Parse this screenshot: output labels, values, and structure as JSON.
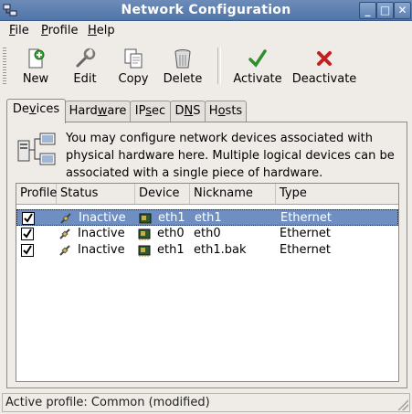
{
  "window": {
    "title": "Network Configuration"
  },
  "menubar": {
    "items": [
      {
        "label": "File",
        "mnemonic": "F",
        "rest": "ile"
      },
      {
        "label": "Profile",
        "mnemonic": "P",
        "rest": "rofile"
      },
      {
        "label": "Help",
        "mnemonic": "H",
        "rest": "elp"
      }
    ]
  },
  "toolbar": {
    "new_label": "New",
    "edit_label": "Edit",
    "copy_label": "Copy",
    "delete_label": "Delete",
    "activate_label": "Activate",
    "deactivate_label": "Deactivate"
  },
  "tabs": [
    {
      "label": "Devices",
      "pre": "De",
      "mnemonic": "v",
      "post": "ices",
      "active": true
    },
    {
      "label": "Hardware",
      "pre": "Hard",
      "mnemonic": "w",
      "post": "are",
      "active": false
    },
    {
      "label": "IPsec",
      "pre": "IP",
      "mnemonic": "s",
      "post": "ec",
      "active": false
    },
    {
      "label": "DNS",
      "pre": "D",
      "mnemonic": "N",
      "post": "S",
      "active": false
    },
    {
      "label": "Hosts",
      "pre": "H",
      "mnemonic": "o",
      "post": "sts",
      "active": false
    }
  ],
  "devices": {
    "info_text": "You may configure network devices associated with physical hardware here.  Multiple logical devices can be associated with a single piece of hardware.",
    "columns": [
      "Profile",
      "Status",
      "Device",
      "Nickname",
      "Type"
    ],
    "rows": [
      {
        "profile_checked": true,
        "status": "Inactive",
        "device": "eth1",
        "nickname": "eth1",
        "type": "Ethernet",
        "selected": true
      },
      {
        "profile_checked": true,
        "status": "Inactive",
        "device": "eth0",
        "nickname": "eth0",
        "type": "Ethernet",
        "selected": false
      },
      {
        "profile_checked": true,
        "status": "Inactive",
        "device": "eth1",
        "nickname": "eth1.bak",
        "type": "Ethernet",
        "selected": false
      }
    ]
  },
  "statusbar": {
    "text": "Active profile: Common (modified)"
  },
  "colors": {
    "titlebar": "#5a7fb0",
    "selection": "#6f8fc2",
    "window_bg": "#efebe7"
  }
}
